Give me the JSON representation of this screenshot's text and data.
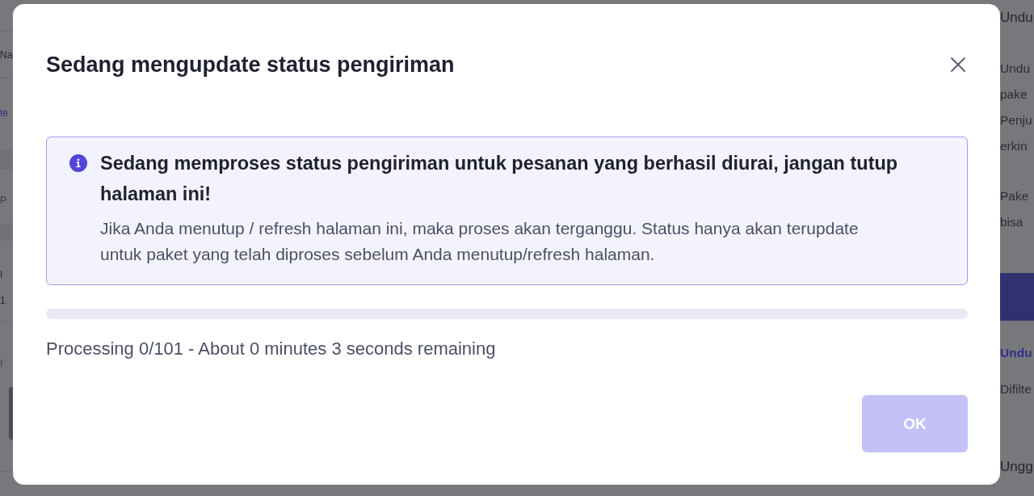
{
  "background": {
    "left_column": [
      {
        "kind": "text",
        "text": "Na"
      },
      {
        "kind": "link",
        "text": "te"
      },
      {
        "kind": "muted",
        "text": "P"
      },
      {
        "kind": "text",
        "text": "I"
      },
      {
        "kind": "text",
        "text": "1"
      },
      {
        "kind": "muted",
        "text": "I"
      },
      {
        "kind": "thumbnail"
      }
    ],
    "right_column": [
      {
        "kind": "heading",
        "text": "Undu"
      },
      {
        "kind": "paragraph",
        "lines": [
          "Undu",
          "pake",
          "Penju",
          "erkin"
        ]
      },
      {
        "kind": "paragraph",
        "lines": [
          "Pake",
          "bisa"
        ]
      },
      {
        "kind": "button"
      },
      {
        "kind": "link",
        "text": "Undu"
      },
      {
        "kind": "text",
        "text": "Difilte"
      },
      {
        "kind": "heading",
        "text": "Ungg"
      }
    ]
  },
  "dialog": {
    "title": "Sedang mengupdate status pengiriman",
    "alert": {
      "title": "Sedang memproses status pengiriman untuk pesanan yang berhasil diurai, jangan tutup halaman ini!",
      "message": "Jika Anda menutup / refresh halaman ini, maka proses akan terganggu. Status hanya akan terupdate untuk paket yang telah diproses sebelum Anda menutup/refresh halaman."
    },
    "progress": {
      "level": 0
    },
    "status": "Processing 0/101 - About 0 minutes 3 seconds remaining",
    "buttons": [
      {
        "label": "OK",
        "disabled": true
      }
    ]
  }
}
